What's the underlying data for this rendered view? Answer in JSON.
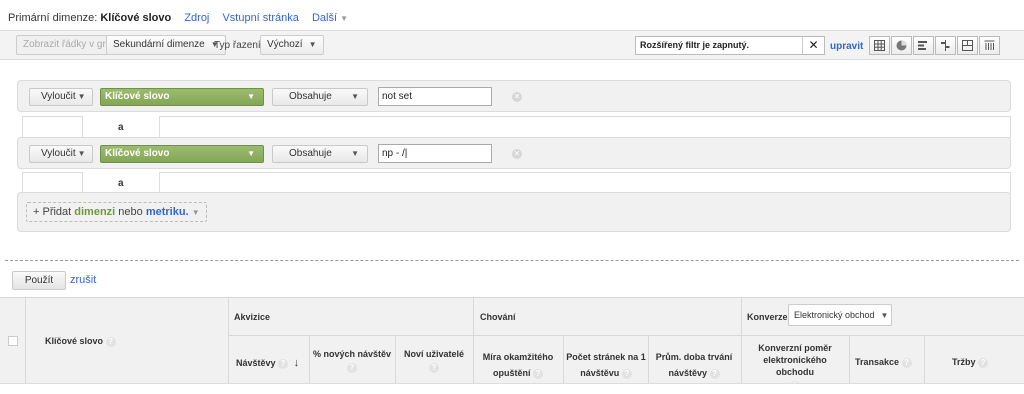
{
  "primary": {
    "label": "Primární dimenze:",
    "current": "Klíčové slovo",
    "links": [
      "Zdroj",
      "Vstupní stránka"
    ],
    "more": "Další"
  },
  "toolbar": {
    "plot_rows": "Zobrazit řádky v grafu",
    "secondary_dimension": "Sekundární dimenze",
    "sort_label": "Typ řazení:",
    "sort_value": "Výchozí",
    "filter_status": "Rozšířený filtr je zapnutý.",
    "edit": "upravit",
    "views": [
      "grid-icon",
      "pie-icon",
      "bar-icon",
      "comparison-icon",
      "pivot-icon",
      "sparkline-icon"
    ]
  },
  "filters": {
    "rows": [
      {
        "exclude": "Vyloučit",
        "dimension": "Klíčové slovo",
        "operator": "Obsahuje",
        "value": "not set"
      },
      {
        "exclude": "Vyloučit",
        "dimension": "Klíčové slovo",
        "operator": "Obsahuje",
        "value": "np - /|"
      }
    ],
    "and_label": "a",
    "add": {
      "prefix": "+ Přidat",
      "dimension": "dimenzi",
      "middle": "nebo",
      "metric": "metriku."
    }
  },
  "actions": {
    "apply": "Použít",
    "cancel": "zrušit"
  },
  "table": {
    "keyword_header": "Klíčové slovo",
    "groups": {
      "acquisition": "Akvizice",
      "behavior": "Chování",
      "conversions": "Konverze",
      "conversion_select": "Elektronický obchod"
    },
    "columns": {
      "visits": "Návštěvy",
      "new_visits": "% nových návštěv",
      "new_users": "Noví uživatelé",
      "bounce": "Míra okamžitého opuštění",
      "pages": "Počet stránek na 1 návštěvu",
      "duration": "Prům. doba trvání návštěvy",
      "ecom_rate": "Konverzní poměr elektronického obchodu",
      "transactions": "Transakce",
      "revenue": "Tržby"
    }
  }
}
